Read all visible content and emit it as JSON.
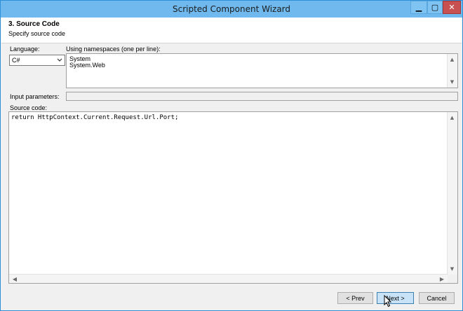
{
  "window": {
    "title": "Scripted Component Wizard"
  },
  "title_buttons": {
    "minimize": "▁",
    "maximize": "▢",
    "close": "✕"
  },
  "header": {
    "step_title": "3. Source Code",
    "step_subtitle": "Specify source code"
  },
  "form": {
    "language_label": "Language:",
    "language_value": "C#",
    "namespaces_label": "Using namespaces (one per line):",
    "namespaces_text": "System\nSystem.Web",
    "input_params_label": "Input parameters:",
    "input_params_value": "",
    "source_label": "Source code:",
    "source_text": "return HttpContext.Current.Request.Url.Port;"
  },
  "buttons": {
    "prev": "< Prev",
    "next": "Next >",
    "cancel": "Cancel"
  },
  "icons": {
    "chevron": "chevron-down-icon",
    "scroll_up": "scroll-up-icon",
    "scroll_down": "scroll-down-icon"
  },
  "colors": {
    "titlebar": "#6fb9ee",
    "close": "#c75050",
    "primary_button": "#c8e3f8"
  }
}
